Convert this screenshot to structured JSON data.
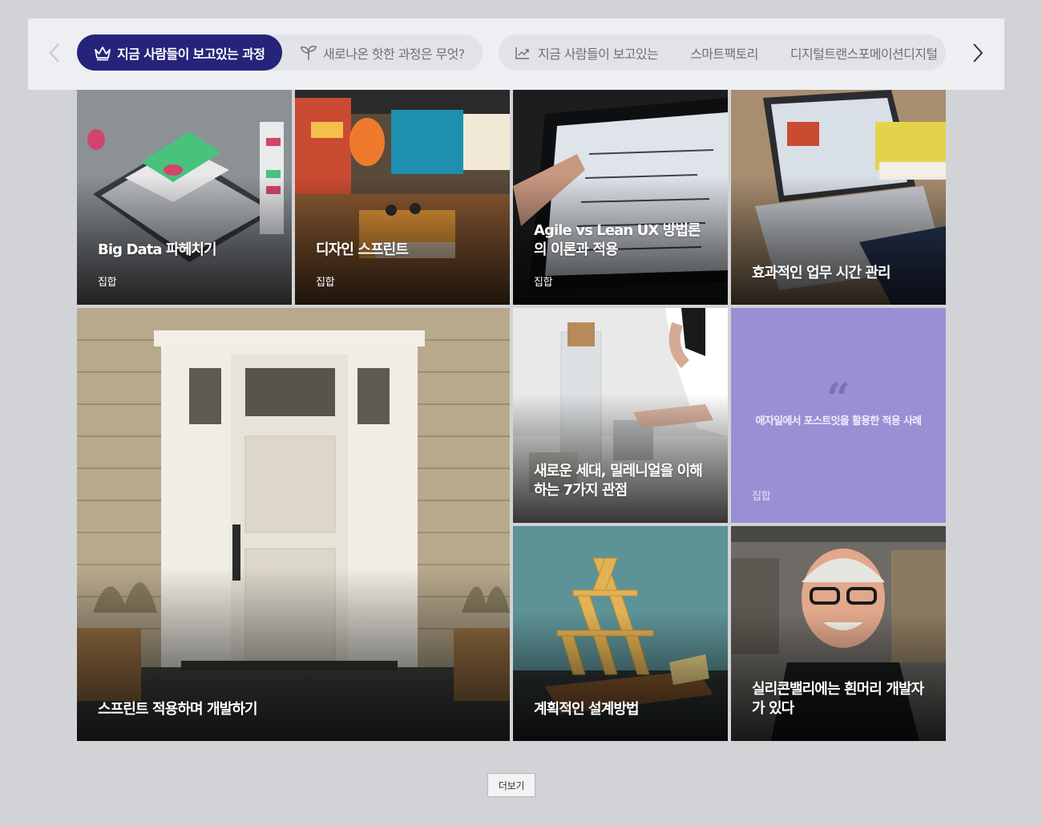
{
  "colors": {
    "page_bg": "#d2d3d6",
    "topbar_bg": "#eeeff3",
    "pill_active_bg": "#26237a",
    "quote_card_bg": "#9990d3"
  },
  "nav": {
    "prev_icon": "chevron-left-icon",
    "next_icon": "chevron-right-icon",
    "primary_tabs": [
      {
        "label": "지금 사람들이 보고있는 과정",
        "icon": "crown-icon",
        "active": true
      },
      {
        "label": "새로나온 핫한 과정은 무엇?",
        "icon": "sprout-icon",
        "active": false
      }
    ],
    "trending": {
      "icon": "trending-up-icon",
      "items": [
        "지금 사람들이 보고있는",
        "스마트팩토리",
        "디지털트랜스포메이션",
        "디지털"
      ]
    }
  },
  "cards": [
    {
      "title": "Big Data 파헤치기",
      "tag": "집합"
    },
    {
      "title": "디자인 스프린트",
      "tag": "집합"
    },
    {
      "title": "Agile vs Lean UX 방법론의 이론과 적용",
      "tag": "집합"
    },
    {
      "title": "효과적인 업무 시간 관리",
      "tag": ""
    },
    {
      "title": "스프린트 적용하며 개발하기",
      "tag": ""
    },
    {
      "title": "새로운 세대, 밀레니얼을 이해하는 7가지 관점",
      "tag": ""
    },
    {
      "quote_mark": "“",
      "quote": "애자일에서 포스트잇을 활용한 적용 사례",
      "tag": "집합"
    },
    {
      "title": "계획적인 설계방법",
      "tag": ""
    },
    {
      "title": "실리콘밸리에는 흰머리 개발자가 있다",
      "tag": ""
    }
  ],
  "more_button": "더보기"
}
